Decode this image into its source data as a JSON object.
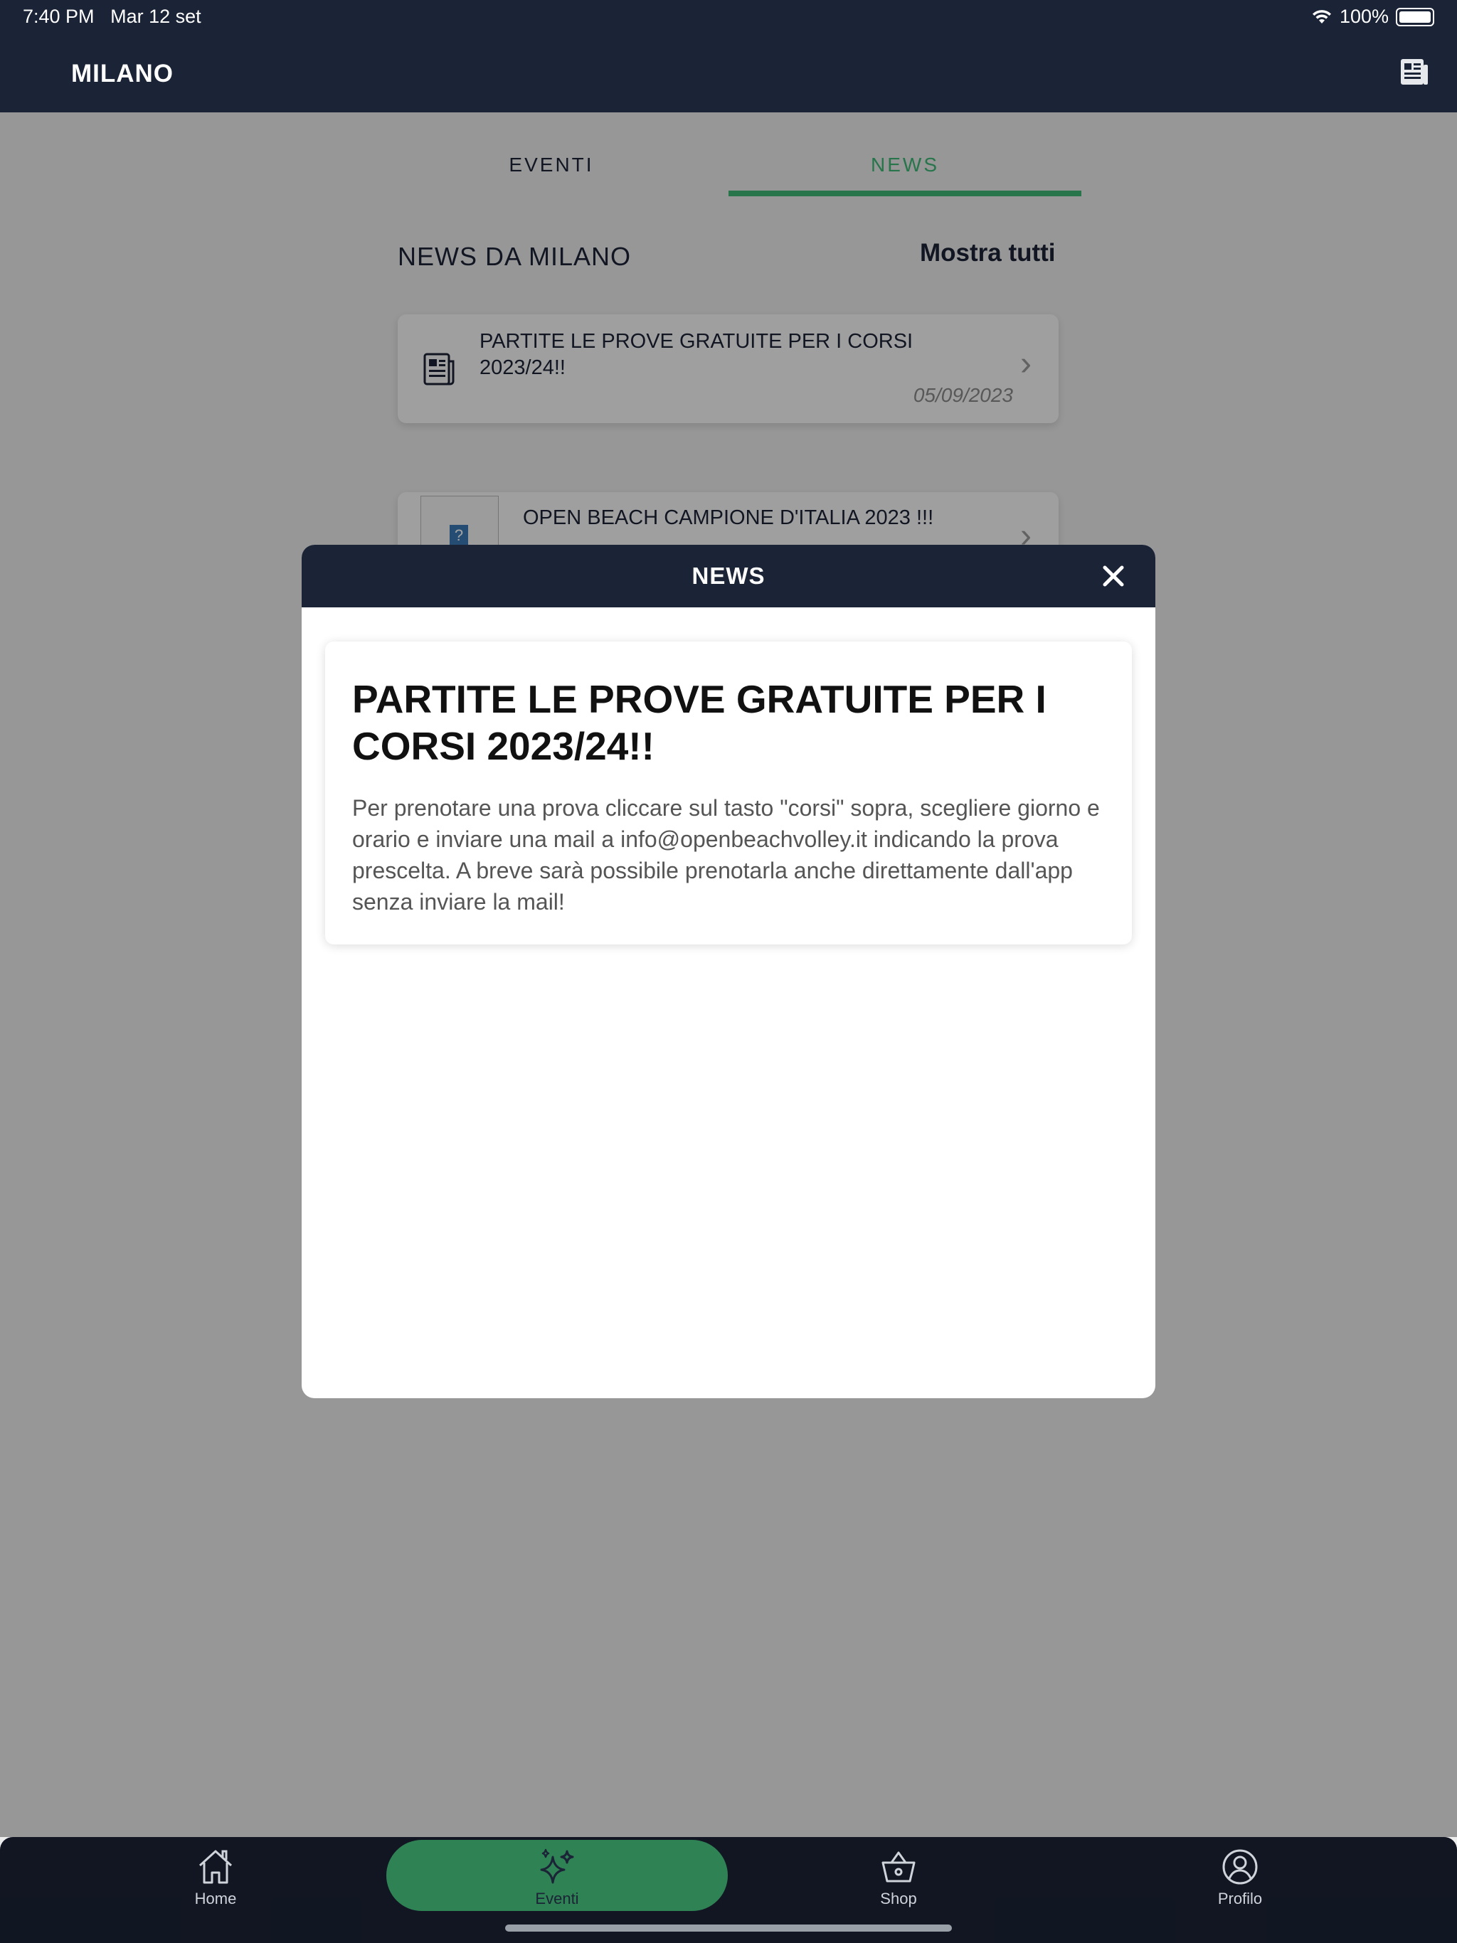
{
  "status_bar": {
    "time": "7:40 PM",
    "date": "Mar 12 set",
    "battery": "100%"
  },
  "header": {
    "title": "MILANO",
    "icon": "newspaper-icon"
  },
  "tabs": [
    {
      "label": "EVENTI",
      "active": false
    },
    {
      "label": "NEWS",
      "active": true
    }
  ],
  "section": {
    "title": "NEWS DA MILANO",
    "show_all": "Mostra tutti"
  },
  "news_list": [
    {
      "title": "PARTITE LE PROVE GRATUITE PER I CORSI 2023/24!!",
      "date": "05/09/2023",
      "icon": "newspaper-icon"
    },
    {
      "title": "OPEN BEACH CAMPIONE D'ITALIA 2023 !!!",
      "icon": "image-placeholder-icon"
    }
  ],
  "modal": {
    "title": "NEWS",
    "close_icon": "close-icon",
    "article_title": "PARTITE LE PROVE GRATUITE PER I CORSI 2023/24!!",
    "article_body": "Per prenotare una prova cliccare sul tasto \"corsi\" sopra, scegliere giorno e orario e inviare una mail a info@openbeachvolley.it indicando la prova prescelta. A breve sarà possibile prenotarla anche direttamente dall'app senza inviare la mail!"
  },
  "bottom_nav": [
    {
      "label": "Home",
      "icon": "home-icon",
      "active": false
    },
    {
      "label": "Eventi",
      "icon": "sparkles-icon",
      "active": true
    },
    {
      "label": "Shop",
      "icon": "basket-icon",
      "active": false
    },
    {
      "label": "Profilo",
      "icon": "user-circle-icon",
      "active": false
    }
  ],
  "colors": {
    "navy": "#1b2336",
    "accent_green": "#3fb777",
    "active_pill": "#3a9f67"
  }
}
